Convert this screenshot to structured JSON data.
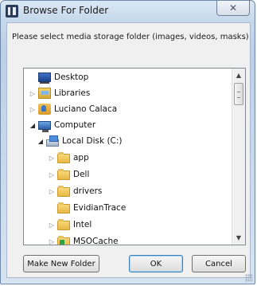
{
  "window": {
    "title": "Browse For Folder",
    "close_glyph": "✕"
  },
  "dialog": {
    "prompt": "Please select media storage folder (images, videos, masks)"
  },
  "tree": {
    "items": [
      {
        "label": "Desktop",
        "icon": "desktop-icon",
        "expander": ""
      },
      {
        "label": "Libraries",
        "icon": "libraries-icon",
        "expander": "▷"
      },
      {
        "label": "Luciano Calaca",
        "icon": "user-folder-icon",
        "expander": "▷"
      },
      {
        "label": "Computer",
        "icon": "computer-icon",
        "expander": "◢"
      },
      {
        "label": "Local Disk (C:)",
        "icon": "local-disk-icon",
        "expander": "◢"
      },
      {
        "label": "app",
        "icon": "folder-icon",
        "expander": "▷"
      },
      {
        "label": "Dell",
        "icon": "folder-icon",
        "expander": "▷"
      },
      {
        "label": "drivers",
        "icon": "folder-icon",
        "expander": "▷"
      },
      {
        "label": "EvidianTrace",
        "icon": "folder-icon",
        "expander": ""
      },
      {
        "label": "Intel",
        "icon": "folder-icon",
        "expander": "▷"
      },
      {
        "label": "MSOCache",
        "icon": "folder-icon",
        "expander": "▷"
      }
    ]
  },
  "scrollbar": {
    "up_glyph": "▲",
    "down_glyph": "▼"
  },
  "buttons": {
    "make_new_folder": "Make New Folder",
    "ok": "OK",
    "cancel": "Cancel"
  },
  "colors": {
    "title_bar": "#c7d9ec",
    "dialog_bg": "#f0f0f0",
    "default_button_border": "#3c7fb1"
  }
}
